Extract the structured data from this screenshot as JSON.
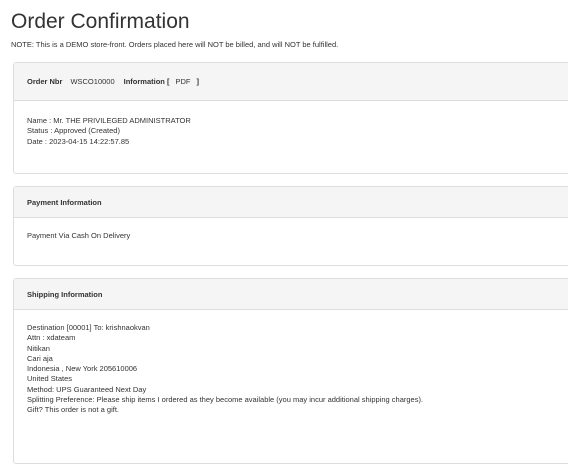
{
  "page": {
    "title": "Order Confirmation",
    "note": "NOTE: This is a DEMO store-front. Orders placed here will NOT be billed, and will NOT be fulfilled."
  },
  "order_panel": {
    "order_nbr_label": "Order Nbr",
    "order_nbr_value": "WSCO10000",
    "information_label": "Information [",
    "pdf_link": "PDF",
    "bracket_close": "]",
    "name_line": "Name : Mr. THE PRIVILEGED ADMINISTRATOR",
    "status_line": "Status : Approved (Created)",
    "date_line": "Date : 2023-04-15 14:22:57.85"
  },
  "payment_panel": {
    "heading": "Payment Information",
    "method": "Payment Via Cash On Delivery"
  },
  "shipping_panel": {
    "heading": "Shipping Information",
    "lines": [
      "Destination [00001] To: krishnaokvan",
      "Attn : xdateam",
      "Nitikan",
      "Cari aja",
      "Indonesia , New York 205610006",
      "United States",
      "Method: UPS Guaranteed Next Day",
      "Splitting Preference: Please ship items I ordered as they become available (you may incur additional shipping charges).",
      "Gift? This order is not a gift."
    ]
  }
}
